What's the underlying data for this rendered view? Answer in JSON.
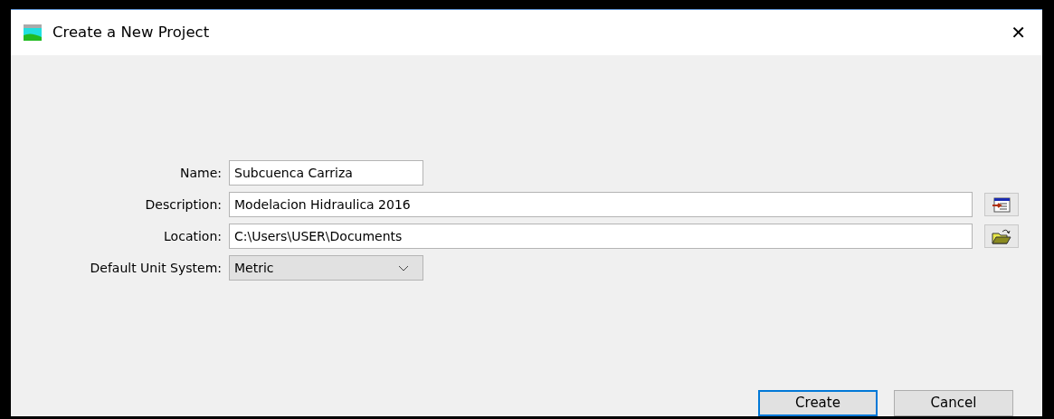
{
  "window": {
    "title": "Create a New Project",
    "close": "✕"
  },
  "fields": [
    {
      "kind": "short",
      "label": "Name:",
      "value": "Subcuenca Carriza"
    },
    {
      "kind": "edit",
      "label": "Description:",
      "value": "Modelacion Hidraulica 2016"
    },
    {
      "kind": "browse",
      "label": "Location:",
      "value": "C:\\Users\\USER\\Documents"
    },
    {
      "kind": "select",
      "label": "Default Unit System:",
      "value": "Metric"
    }
  ],
  "buttons": [
    {
      "label": "Create",
      "default": true
    },
    {
      "label": "Cancel",
      "default": false
    }
  ]
}
